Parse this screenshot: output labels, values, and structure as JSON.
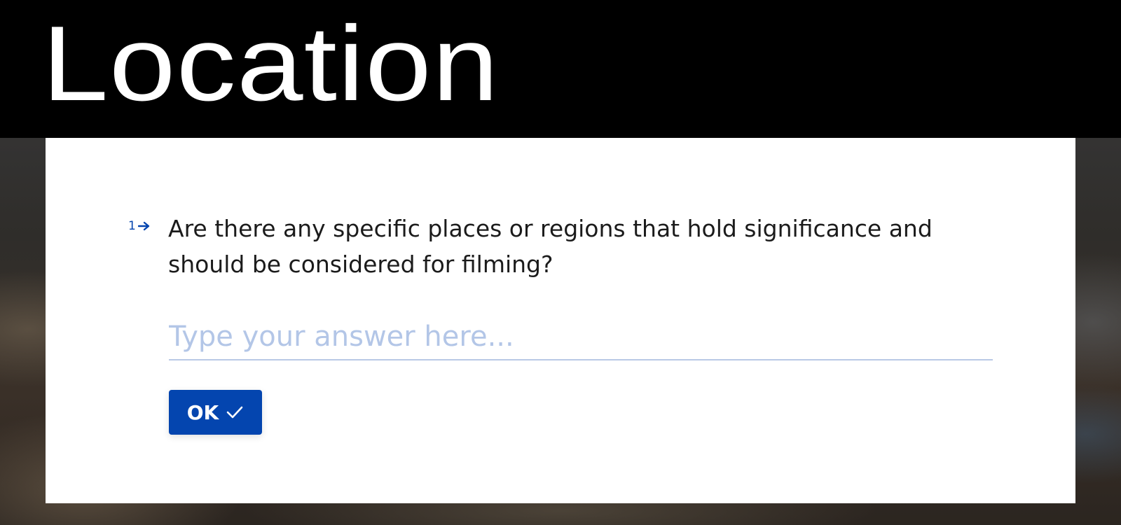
{
  "header": {
    "title": "Location"
  },
  "question": {
    "number": "1",
    "text": "Are there any specific places or regions that hold significance and should be considered for filming?"
  },
  "answer": {
    "placeholder": "Type your answer here...",
    "value": ""
  },
  "ok_button": {
    "label": "OK",
    "icon": "check-icon"
  },
  "colors": {
    "accent": "#0445AF",
    "placeholder": "#B3C6E7",
    "header_bg": "#000000",
    "card_bg": "#FFFFFF"
  }
}
